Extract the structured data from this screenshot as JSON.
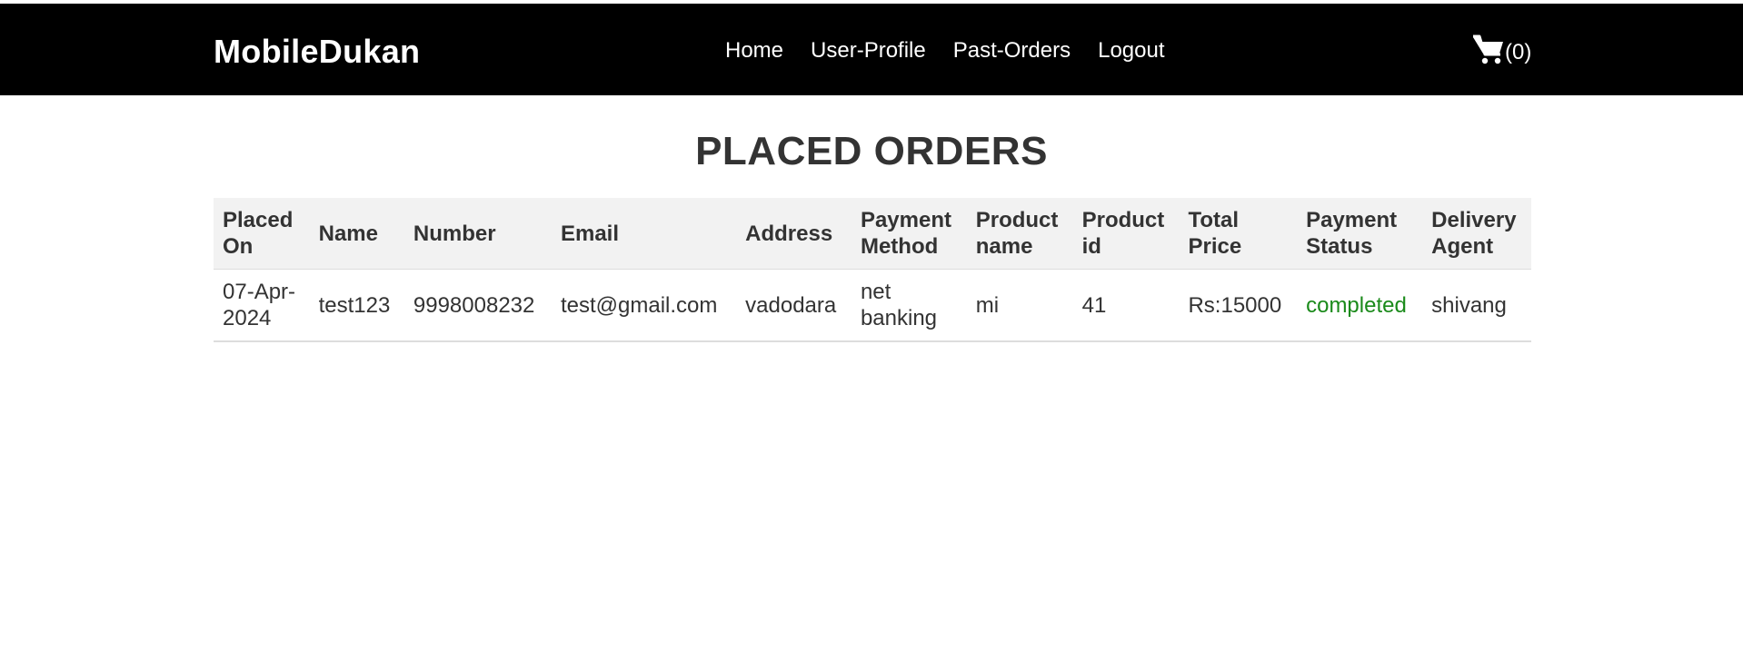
{
  "navbar": {
    "brand": "MobileDukan",
    "links": [
      "Home",
      "User-Profile",
      "Past-Orders",
      "Logout"
    ],
    "cart_count": "(0)"
  },
  "main": {
    "title": "PLACED ORDERS",
    "columns": [
      [
        "Placed",
        "On"
      ],
      [
        "Name"
      ],
      [
        "Number"
      ],
      [
        "Email"
      ],
      [
        "Address"
      ],
      [
        "Payment",
        "Method"
      ],
      [
        "Product",
        "name"
      ],
      [
        "Product",
        "id"
      ],
      [
        "Total",
        "Price"
      ],
      [
        "Payment",
        "Status"
      ],
      [
        "Delivery",
        "Agent"
      ]
    ],
    "rows": [
      {
        "placed_on": [
          "07-Apr-",
          "2024"
        ],
        "name": "test123",
        "number": "9998008232",
        "email": "test@gmail.com",
        "address": "vadodara",
        "payment_method": [
          "net",
          "banking"
        ],
        "product_name": "mi",
        "product_id": "41",
        "total_price": "Rs:15000",
        "payment_status": "completed",
        "delivery_agent": "shivang"
      }
    ]
  },
  "colors": {
    "navbar_bg": "#000000",
    "status_completed": "#1a8a1a",
    "header_row_bg": "#f2f2f2"
  },
  "icons": {
    "cart": "shopping-cart-icon"
  }
}
